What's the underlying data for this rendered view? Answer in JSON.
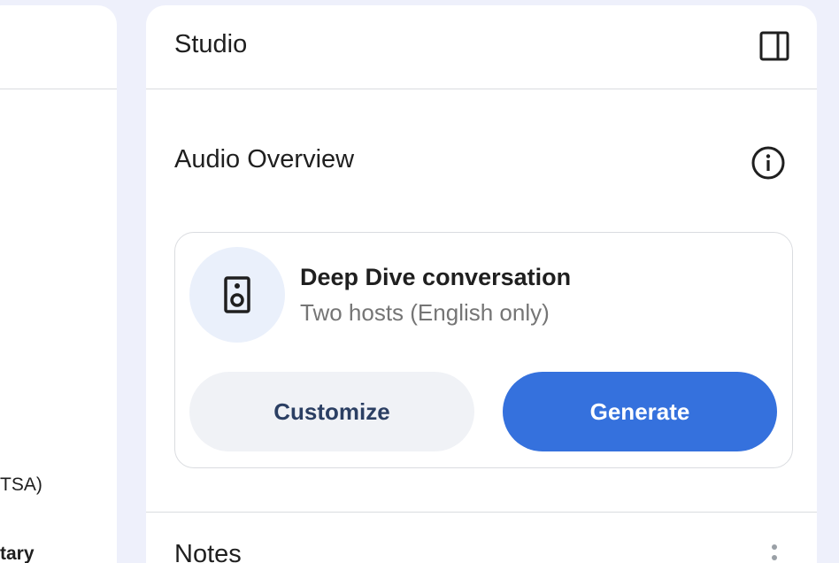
{
  "left_panel": {
    "line1": "TSA)",
    "line2": "tary"
  },
  "studio": {
    "title": "Studio",
    "toggle_icon": "side-panel-icon"
  },
  "audio_overview": {
    "title": "Audio Overview",
    "info_icon": "info-icon",
    "card": {
      "icon": "speaker-icon",
      "title": "Deep Dive conversation",
      "subtitle": "Two hosts (English only)",
      "customize_label": "Customize",
      "generate_label": "Generate"
    }
  },
  "notes": {
    "title": "Notes",
    "menu_icon": "more-vert-icon"
  },
  "colors": {
    "accent": "#3571dd",
    "page_bg": "#eef0fb",
    "icon_circle_bg": "#eaf0fb"
  }
}
